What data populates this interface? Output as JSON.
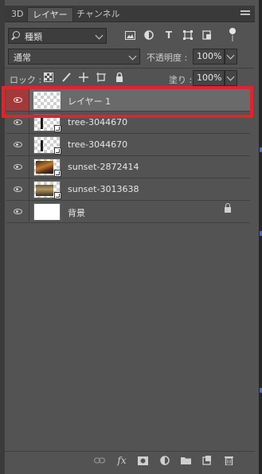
{
  "tabs": [
    {
      "label": "3D"
    },
    {
      "label": "レイヤー"
    },
    {
      "label": "チャンネル"
    }
  ],
  "filter": {
    "kind_label": "種類"
  },
  "blend": {
    "mode": "通常",
    "opacity_label": "不透明度 :",
    "opacity_value": "100%"
  },
  "lock": {
    "label": "ロック :",
    "fill_label": "塗り :",
    "fill_value": "100%"
  },
  "layers": [
    {
      "name": "レイヤー 1",
      "selected": true,
      "thumb": "checker"
    },
    {
      "name": "tree-3044670",
      "thumb": "tree"
    },
    {
      "name": "tree-3044670",
      "thumb": "tree"
    },
    {
      "name": "sunset-2872414",
      "thumb": "sunset"
    },
    {
      "name": "sunset-3013638",
      "thumb": "sunset2"
    },
    {
      "name": "背景",
      "thumb": "white",
      "locked": true
    }
  ],
  "colors": {
    "panel": "#535353",
    "highlight": "#e0242b",
    "selected_eye": "#a33a3a"
  },
  "bottom_icons": [
    "link-icon",
    "fx-icon",
    "mask-icon",
    "adjustment-icon",
    "folder-icon",
    "new-layer-icon",
    "trash-icon"
  ]
}
